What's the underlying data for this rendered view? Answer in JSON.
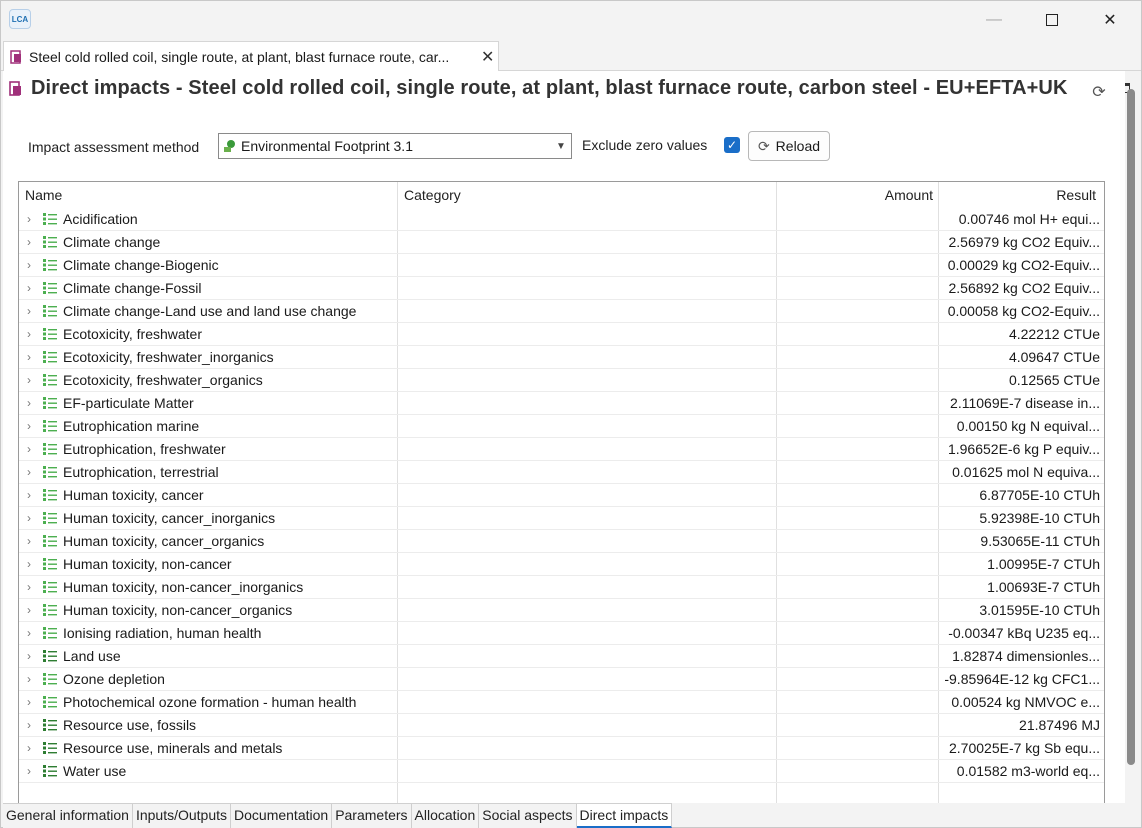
{
  "app": {
    "logo_text": "LCA"
  },
  "window": {
    "minimize": "—",
    "close": "✕"
  },
  "editor_tab": {
    "label": "Steel cold rolled coil, single route, at plant, blast furnace route, car...",
    "close": "✕"
  },
  "page": {
    "title": "Direct impacts - Steel cold rolled coil, single route, at plant, blast furnace route, carbon steel - EU+EFTA+UK"
  },
  "toolbar": {
    "method_label": "Impact assessment method",
    "method_value": "Environmental Footprint 3.1",
    "exclude_label": "Exclude zero values",
    "exclude_checked": true,
    "reload_label": "Reload"
  },
  "table": {
    "headers": {
      "name": "Name",
      "category": "Category",
      "amount": "Amount",
      "result": "Result"
    },
    "rows": [
      {
        "name": "Acidification",
        "result": "0.00746 mol H+ equi..."
      },
      {
        "name": "Climate change",
        "result": "2.56979 kg CO2 Equiv..."
      },
      {
        "name": "Climate change-Biogenic",
        "result": "0.00029 kg CO2-Equiv..."
      },
      {
        "name": "Climate change-Fossil",
        "result": "2.56892 kg CO2 Equiv..."
      },
      {
        "name": "Climate change-Land use and land use change",
        "result": "0.00058 kg CO2-Equiv..."
      },
      {
        "name": "Ecotoxicity, freshwater",
        "result": "4.22212 CTUe"
      },
      {
        "name": "Ecotoxicity, freshwater_inorganics",
        "result": "4.09647 CTUe"
      },
      {
        "name": "Ecotoxicity, freshwater_organics",
        "result": "0.12565 CTUe"
      },
      {
        "name": "EF-particulate Matter",
        "result": "2.11069E-7 disease in..."
      },
      {
        "name": "Eutrophication marine",
        "result": "0.00150 kg N equival..."
      },
      {
        "name": "Eutrophication, freshwater",
        "result": "1.96652E-6 kg P equiv..."
      },
      {
        "name": "Eutrophication, terrestrial",
        "result": "0.01625 mol N equiva..."
      },
      {
        "name": "Human toxicity, cancer",
        "result": "6.87705E-10  CTUh"
      },
      {
        "name": "Human toxicity, cancer_inorganics",
        "result": "5.92398E-10  CTUh"
      },
      {
        "name": "Human toxicity, cancer_organics",
        "result": "9.53065E-11  CTUh"
      },
      {
        "name": "Human toxicity, non-cancer",
        "result": "1.00995E-7 CTUh"
      },
      {
        "name": "Human toxicity, non-cancer_inorganics",
        "result": "1.00693E-7 CTUh"
      },
      {
        "name": "Human toxicity, non-cancer_organics",
        "result": "3.01595E-10 CTUh"
      },
      {
        "name": "Ionising radiation, human health",
        "result": "-0.00347 kBq U235 eq..."
      },
      {
        "name": "Land use",
        "result": "1.82874 dimensionles..."
      },
      {
        "name": "Ozone depletion",
        "result": "-9.85964E-12 kg CFC1..."
      },
      {
        "name": "Photochemical ozone formation - human health",
        "result": "0.00524 kg NMVOC e..."
      },
      {
        "name": "Resource use, fossils",
        "result": "21.87496 MJ"
      },
      {
        "name": "Resource use, minerals and metals",
        "result": "2.70025E-7 kg Sb equ..."
      },
      {
        "name": "Water use",
        "result": "0.01582 m3-world eq..."
      }
    ]
  },
  "bottom_tabs": [
    "General information",
    "Inputs/Outputs",
    "Documentation",
    "Parameters",
    "Allocation",
    "Social aspects",
    "Direct impacts"
  ],
  "active_bottom_tab": "Direct impacts",
  "colors": {
    "accent": "#1a6ec8",
    "list_icon": "#3a9a3a",
    "process_icon": "#a0307a"
  }
}
